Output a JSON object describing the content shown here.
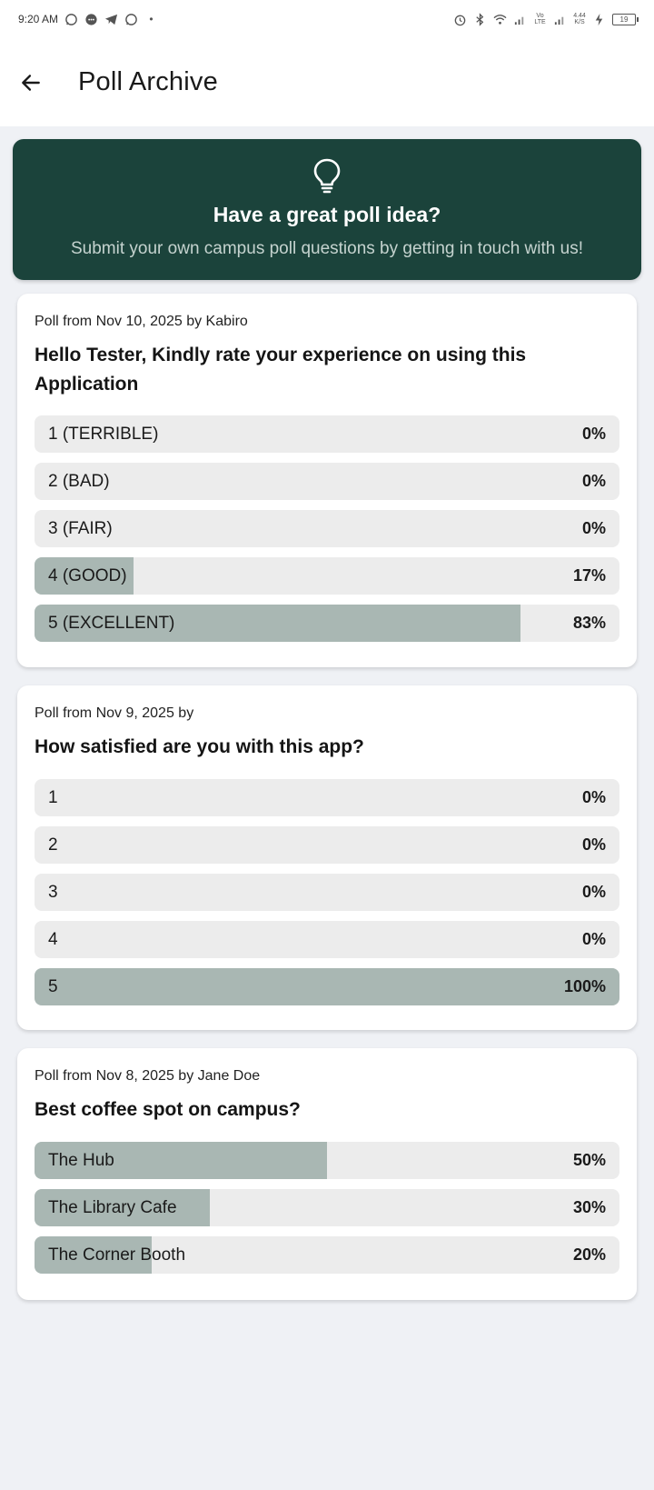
{
  "status_bar": {
    "time": "9:20 AM",
    "dot": "•",
    "network_speed": "4.44 K/S",
    "battery": "19"
  },
  "app_bar": {
    "title": "Poll Archive"
  },
  "banner": {
    "icon": "lightbulb-icon",
    "title": "Have a great poll idea?",
    "subtitle": "Submit your own campus poll questions by getting in touch with us!",
    "background": "#1b433b"
  },
  "colors": {
    "bar_fill": "#a9b7b3",
    "bar_track": "#ececec"
  },
  "polls": [
    {
      "meta": "Poll from Nov 10, 2025 by Kabiro",
      "question": "Hello Tester, Kindly rate your experience on using this Application",
      "options": [
        {
          "label": "1 (TERRIBLE)",
          "percent": 0,
          "percent_label": "0%"
        },
        {
          "label": "2 (BAD)",
          "percent": 0,
          "percent_label": "0%"
        },
        {
          "label": "3 (FAIR)",
          "percent": 0,
          "percent_label": "0%"
        },
        {
          "label": "4 (GOOD)",
          "percent": 17,
          "percent_label": "17%"
        },
        {
          "label": "5 (EXCELLENT)",
          "percent": 83,
          "percent_label": "83%"
        }
      ]
    },
    {
      "meta": "Poll from Nov 9, 2025 by",
      "question": "How satisfied are you with this app?",
      "options": [
        {
          "label": "1",
          "percent": 0,
          "percent_label": "0%"
        },
        {
          "label": "2",
          "percent": 0,
          "percent_label": "0%"
        },
        {
          "label": "3",
          "percent": 0,
          "percent_label": "0%"
        },
        {
          "label": "4",
          "percent": 0,
          "percent_label": "0%"
        },
        {
          "label": "5",
          "percent": 100,
          "percent_label": "100%"
        }
      ]
    },
    {
      "meta": "Poll from Nov 8, 2025 by Jane Doe",
      "question": "Best coffee spot on campus?",
      "options": [
        {
          "label": "The Hub",
          "percent": 50,
          "percent_label": "50%"
        },
        {
          "label": "The Library Cafe",
          "percent": 30,
          "percent_label": "30%"
        },
        {
          "label": "The Corner Booth",
          "percent": 20,
          "percent_label": "20%"
        }
      ]
    }
  ]
}
